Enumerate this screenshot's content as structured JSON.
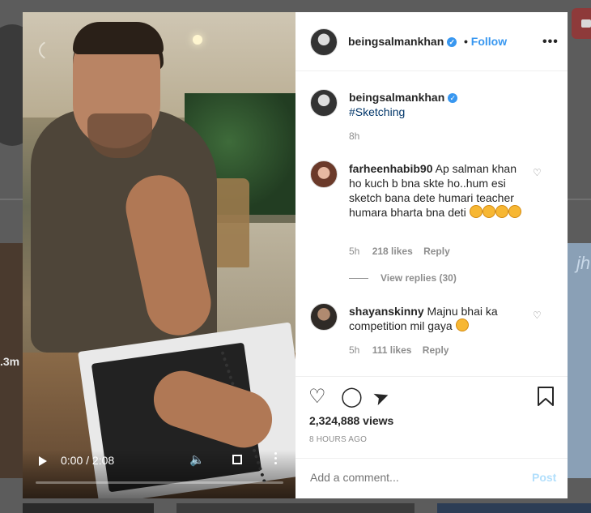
{
  "post": {
    "username": "beingsalmankhan",
    "follow_label": "Follow",
    "separator": "•",
    "caption_tag": "#Sketching",
    "caption_age": "8h",
    "views": "2,324,888 views",
    "posted": "8 HOURS AGO"
  },
  "video": {
    "time": "0:00 / 2:08"
  },
  "comments": [
    {
      "username": "farheenhabib90",
      "text": "Ap salman khan ho kuch b bna skte ho..hum esi sketch bana dete humari teacher humara bharta bna deti",
      "age": "5h",
      "likes": "218 likes",
      "reply": "Reply",
      "view_replies": "View replies (30)"
    },
    {
      "username": "shayanskinny",
      "text": "Majnu bhai ka competition mil gaya",
      "age": "5h",
      "likes": "111 likes",
      "reply": "Reply"
    }
  ],
  "compose": {
    "placeholder": "Add a comment...",
    "post_label": "Post"
  },
  "background": {
    "left_text": ".3m"
  },
  "colors": {
    "link": "#3897f0",
    "hashtag": "#003569",
    "muted": "#8e8e8e",
    "text": "#262626"
  },
  "icons": [
    "heart-icon",
    "comment-icon",
    "share-icon",
    "bookmark-icon",
    "more-icon",
    "verified-icon",
    "play-icon",
    "volume-icon",
    "fullscreen-icon"
  ]
}
